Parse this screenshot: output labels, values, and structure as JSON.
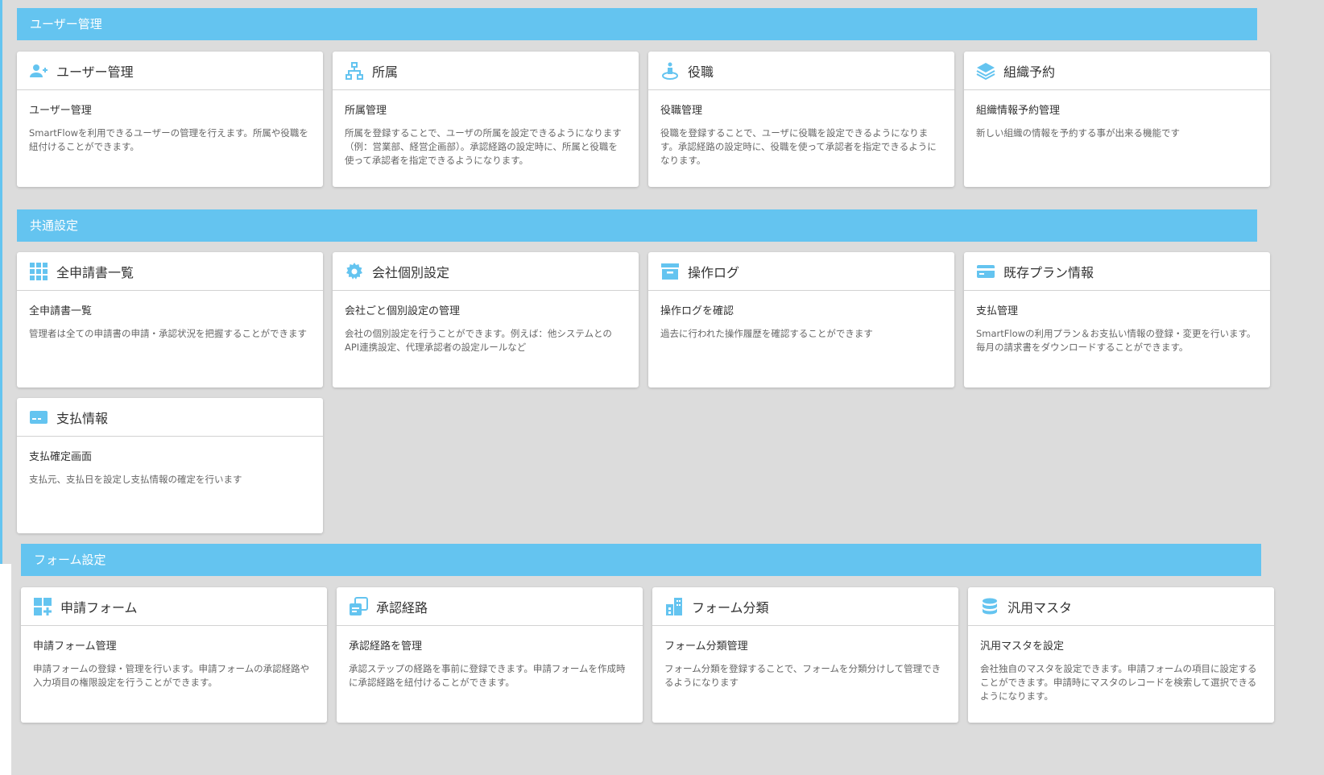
{
  "colors": {
    "accent": "#64c4f0",
    "background": "#dcdcdc",
    "card": "#ffffff"
  },
  "sections": [
    {
      "title": "ユーザー管理",
      "cards": [
        {
          "icon": "add-user-icon",
          "title": "ユーザー管理",
          "subtitle": "ユーザー管理",
          "desc": "SmartFlowを利用できるユーザーの管理を行えます。所属や役職を紐付けることができます。"
        },
        {
          "icon": "org-chart-icon",
          "title": "所属",
          "subtitle": "所属管理",
          "desc": "所属を登録することで、ユーザの所属を設定できるようになります（例：営業部、経営企画部）。承認経路の設定時に、所属と役職を使って承認者を指定できるようになります。"
        },
        {
          "icon": "position-icon",
          "title": "役職",
          "subtitle": "役職管理",
          "desc": "役職を登録することで、ユーザに役職を設定できるようになります。承認経路の設定時に、役職を使って承認者を指定できるようになります。"
        },
        {
          "icon": "layers-icon",
          "title": "組織予約",
          "subtitle": "組織情報予約管理",
          "desc": "新しい組織の情報を予約する事が出来る機能です"
        }
      ]
    },
    {
      "title": "共通設定",
      "cards": [
        {
          "icon": "grid-apps-icon",
          "title": "全申請書一覧",
          "subtitle": "全申請書一覧",
          "desc": "管理者は全ての申請書の申請・承認状況を把握することができます"
        },
        {
          "icon": "gear-icon",
          "title": "会社個別設定",
          "subtitle": "会社ごと個別設定の管理",
          "desc": "会社の個別設定を行うことができます。例えば：他システムとのAPI連携設定、代理承認者の設定ルールなど"
        },
        {
          "icon": "archive-icon",
          "title": "操作ログ",
          "subtitle": "操作ログを確認",
          "desc": "過去に行われた操作履歴を確認することができます"
        },
        {
          "icon": "credit-card-icon",
          "title": "既存プラン情報",
          "subtitle": "支払管理",
          "desc": "SmartFlowの利用プラン＆お支払い情報の登録・変更を行います。毎月の請求書をダウンロードすることができます。"
        },
        {
          "icon": "payment-card-icon",
          "title": "支払情報",
          "subtitle": "支払確定画面",
          "desc": "支払元、支払日を設定し支払情報の確定を行います"
        }
      ]
    },
    {
      "title": "フォーム設定",
      "cards": [
        {
          "icon": "add-form-icon",
          "title": "申請フォーム",
          "subtitle": "申請フォーム管理",
          "desc": "申請フォームの登録・管理を行います。申請フォームの承認経路や入力項目の権限設定を行うことができます。"
        },
        {
          "icon": "route-icon",
          "title": "承認経路",
          "subtitle": "承認経路を管理",
          "desc": "承認ステップの経路を事前に登録できます。申請フォームを作成時に承認経路を紐付けることができます。"
        },
        {
          "icon": "building-icon",
          "title": "フォーム分類",
          "subtitle": "フォーム分類管理",
          "desc": "フォーム分類を登録することで、フォームを分類分けして管理できるようになります"
        },
        {
          "icon": "database-icon",
          "title": "汎用マスタ",
          "subtitle": "汎用マスタを設定",
          "desc": "会社独自のマスタを設定できます。申請フォームの項目に設定することができます。申請時にマスタのレコードを検索して選択できるようになります。"
        }
      ]
    }
  ]
}
